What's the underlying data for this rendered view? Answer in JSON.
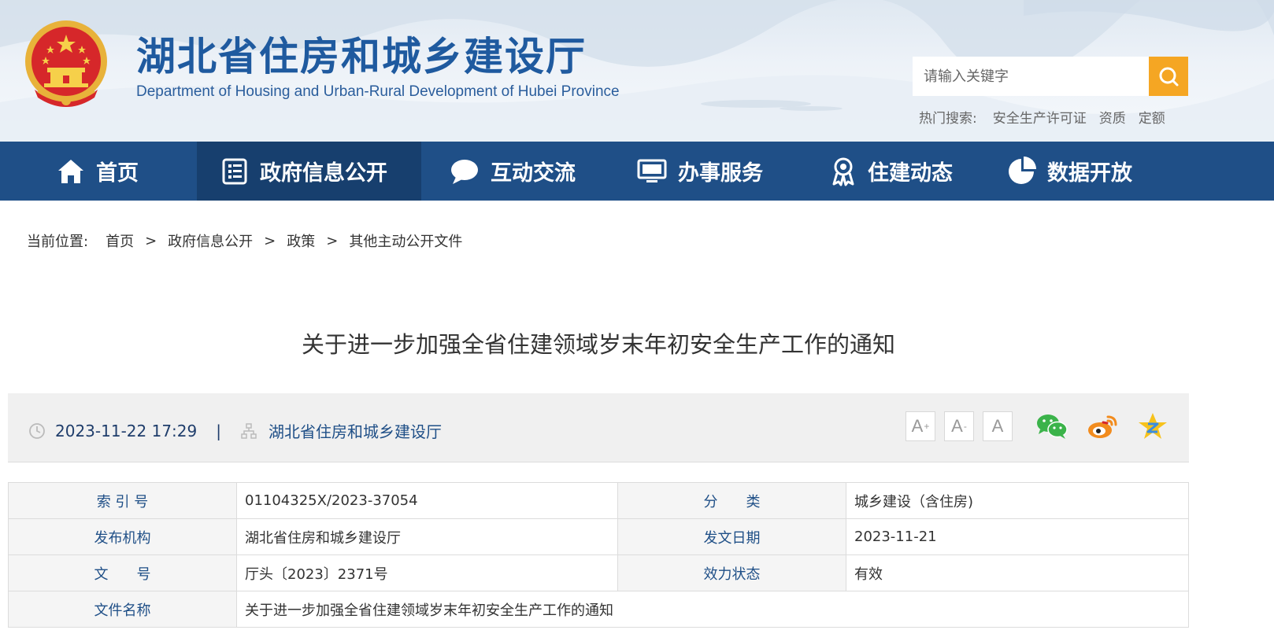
{
  "header": {
    "title": "湖北省住房和城乡建设厅",
    "subtitle": "Department of Housing and Urban-Rural Development of Hubei Province",
    "search_placeholder": "请输入关键字",
    "hot_label": "热门搜索:",
    "hot_items": [
      "安全生产许可证",
      "资质",
      "定额"
    ]
  },
  "nav": {
    "items": [
      {
        "label": "首页",
        "icon": "home-icon"
      },
      {
        "label": "政府信息公开",
        "icon": "document-list-icon"
      },
      {
        "label": "互动交流",
        "icon": "chat-bubble-icon"
      },
      {
        "label": "办事服务",
        "icon": "monitor-icon"
      },
      {
        "label": "住建动态",
        "icon": "badge-icon"
      },
      {
        "label": "数据开放",
        "icon": "pie-chart-icon"
      }
    ],
    "active_index": 1
  },
  "breadcrumb": {
    "label": "当前位置:",
    "items": [
      "首页",
      "政府信息公开",
      "政策",
      "其他主动公开文件"
    ],
    "separator": ">"
  },
  "article": {
    "title": "关于进一步加强全省住建领域岁末年初安全生产工作的通知",
    "datetime": "2023-11-22 17:29",
    "separator": "|",
    "publisher": "湖北省住房和城乡建设厅"
  },
  "font_controls": {
    "increase": "A",
    "decrease": "A",
    "default": "A",
    "increase_mark": "+",
    "decrease_mark": "-"
  },
  "share": [
    "wechat-icon",
    "weibo-icon",
    "qzone-icon"
  ],
  "info": {
    "index_label": "索 引 号",
    "index_value": "01104325X/2023-37054",
    "category_label": "分　　类",
    "category_value": "城乡建设（含住房)",
    "org_label": "发布机构",
    "org_value": "湖北省住房和城乡建设厅",
    "date_label": "发文日期",
    "date_value": "2023-11-21",
    "docno_label": "文　　号",
    "docno_value": "厅头〔2023〕2371号",
    "status_label": "效力状态",
    "status_value": "有效",
    "name_label": "文件名称",
    "name_value": "关于进一步加强全省住建领域岁末年初安全生产工作的通知"
  },
  "colors": {
    "nav_bg": "#1f4f87",
    "nav_active": "#173f6e",
    "search_button": "#f5a623",
    "title_blue": "#1f5a9f"
  }
}
